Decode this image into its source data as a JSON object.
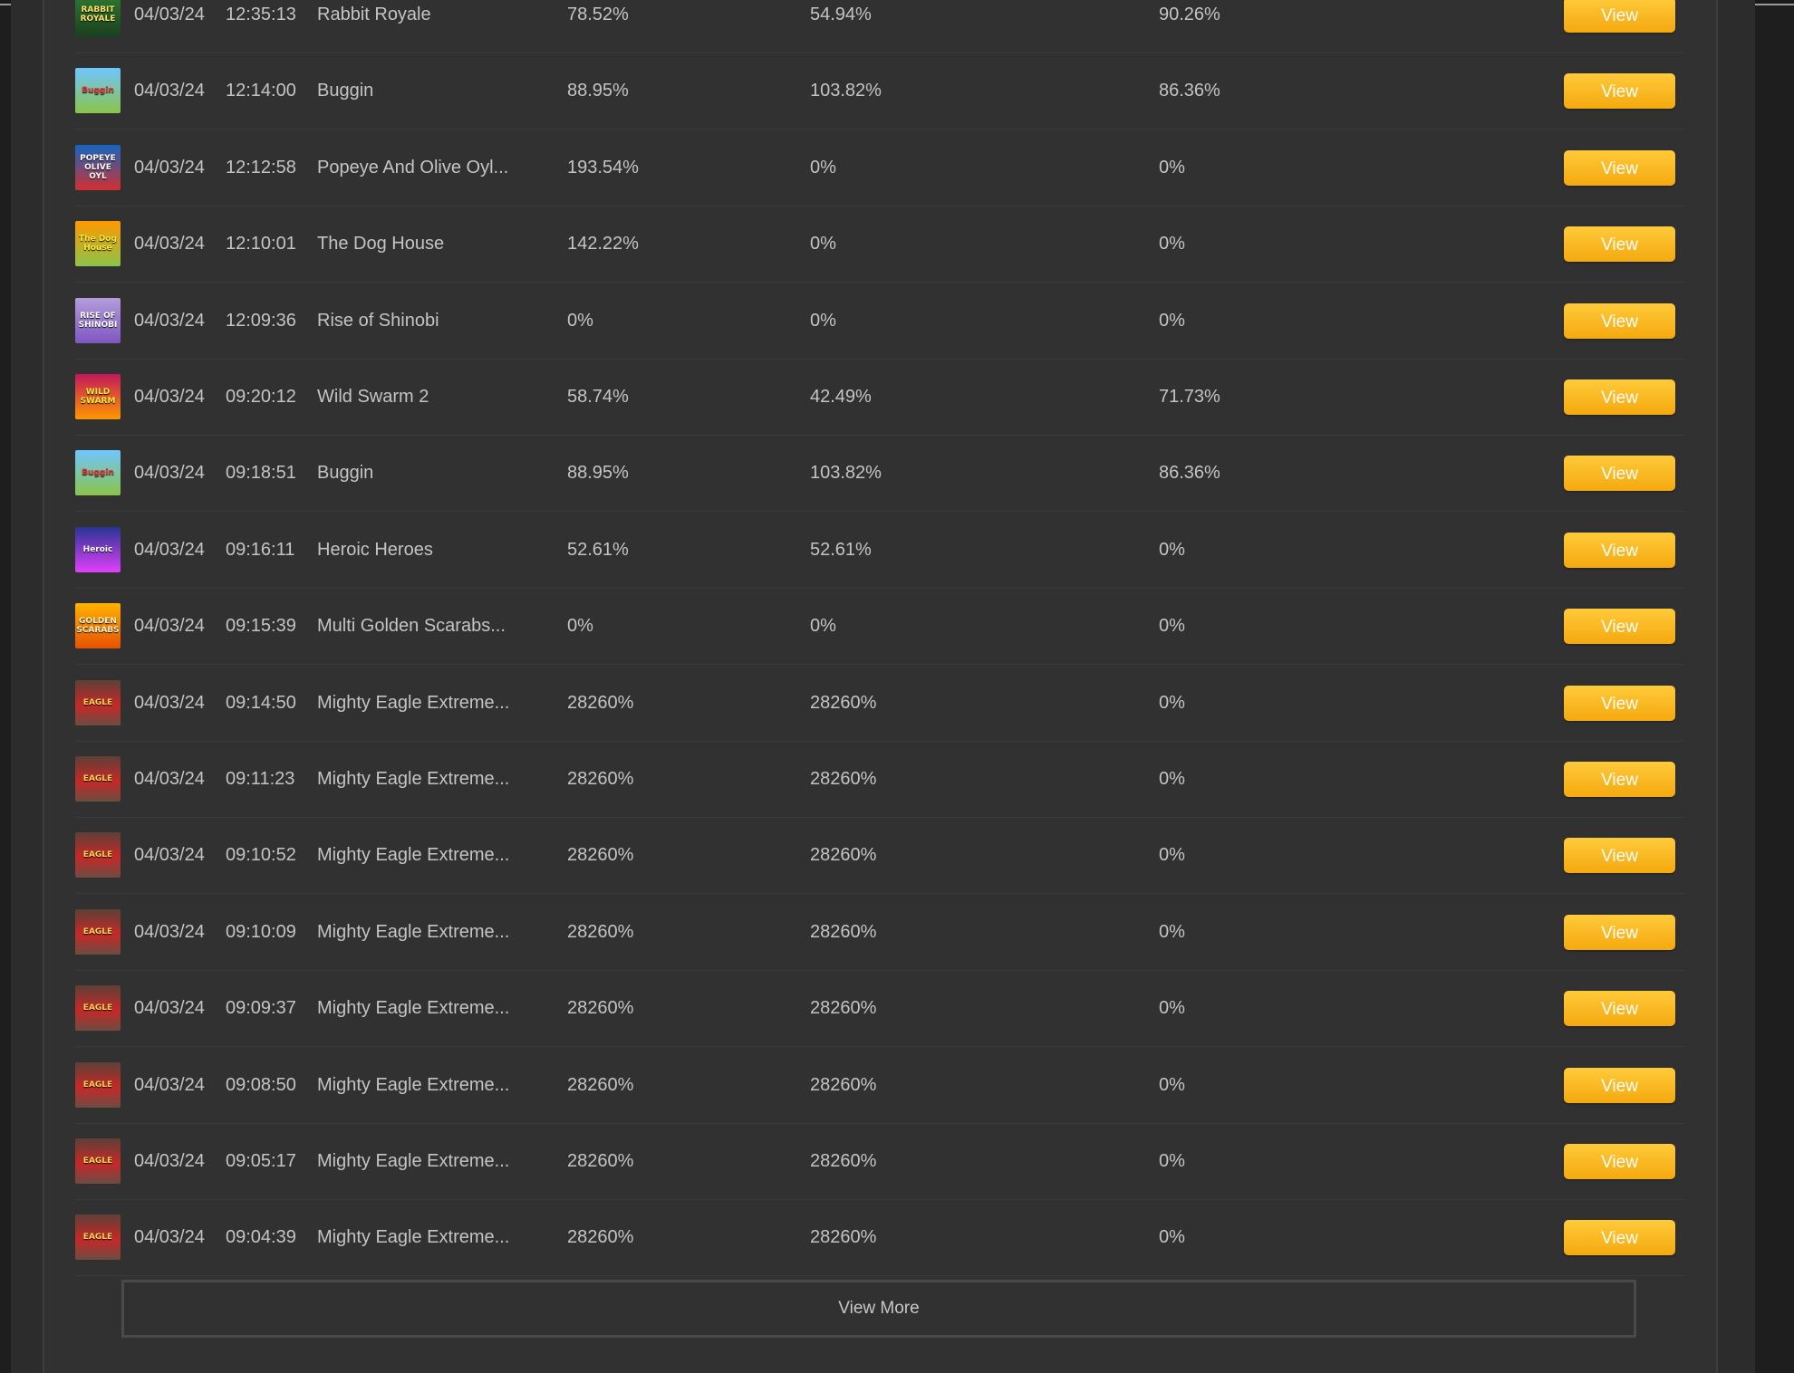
{
  "rows": [
    {
      "date": "04/03/24",
      "time": "12:35:13",
      "game": "Rabbit Royale",
      "r1": "78.52%",
      "r2": "54.94%",
      "r3": "90.26%",
      "thumb": "RABBIT ROYALE",
      "view": "View"
    },
    {
      "date": "04/03/24",
      "time": "12:14:00",
      "game": "Buggin",
      "r1": "88.95%",
      "r2": "103.82%",
      "r3": "86.36%",
      "thumb": "Buggin",
      "view": "View"
    },
    {
      "date": "04/03/24",
      "time": "12:12:58",
      "game": "Popeye And Olive Oyl...",
      "r1": "193.54%",
      "r2": "0%",
      "r3": "0%",
      "thumb": "POPEYE OLIVE OYL",
      "view": "View"
    },
    {
      "date": "04/03/24",
      "time": "12:10:01",
      "game": "The Dog House",
      "r1": "142.22%",
      "r2": "0%",
      "r3": "0%",
      "thumb": "The Dog House",
      "view": "View"
    },
    {
      "date": "04/03/24",
      "time": "12:09:36",
      "game": "Rise of Shinobi",
      "r1": "0%",
      "r2": "0%",
      "r3": "0%",
      "thumb": "RISE OF SHINOBI",
      "view": "View"
    },
    {
      "date": "04/03/24",
      "time": "09:20:12",
      "game": "Wild Swarm 2",
      "r1": "58.74%",
      "r2": "42.49%",
      "r3": "71.73%",
      "thumb": "WILD SWARM",
      "view": "View"
    },
    {
      "date": "04/03/24",
      "time": "09:18:51",
      "game": "Buggin",
      "r1": "88.95%",
      "r2": "103.82%",
      "r3": "86.36%",
      "thumb": "Buggin",
      "view": "View"
    },
    {
      "date": "04/03/24",
      "time": "09:16:11",
      "game": "Heroic Heroes",
      "r1": "52.61%",
      "r2": "52.61%",
      "r3": "0%",
      "thumb": "Heroic",
      "view": "View"
    },
    {
      "date": "04/03/24",
      "time": "09:15:39",
      "game": "Multi Golden Scarabs...",
      "r1": "0%",
      "r2": "0%",
      "r3": "0%",
      "thumb": "GOLDEN SCARABS",
      "view": "View"
    },
    {
      "date": "04/03/24",
      "time": "09:14:50",
      "game": "Mighty Eagle Extreme...",
      "r1": "28260%",
      "r2": "28260%",
      "r3": "0%",
      "thumb": "EAGLE",
      "view": "View"
    },
    {
      "date": "04/03/24",
      "time": "09:11:23",
      "game": "Mighty Eagle Extreme...",
      "r1": "28260%",
      "r2": "28260%",
      "r3": "0%",
      "thumb": "EAGLE",
      "view": "View"
    },
    {
      "date": "04/03/24",
      "time": "09:10:52",
      "game": "Mighty Eagle Extreme...",
      "r1": "28260%",
      "r2": "28260%",
      "r3": "0%",
      "thumb": "EAGLE",
      "view": "View"
    },
    {
      "date": "04/03/24",
      "time": "09:10:09",
      "game": "Mighty Eagle Extreme...",
      "r1": "28260%",
      "r2": "28260%",
      "r3": "0%",
      "thumb": "EAGLE",
      "view": "View"
    },
    {
      "date": "04/03/24",
      "time": "09:09:37",
      "game": "Mighty Eagle Extreme...",
      "r1": "28260%",
      "r2": "28260%",
      "r3": "0%",
      "thumb": "EAGLE",
      "view": "View"
    },
    {
      "date": "04/03/24",
      "time": "09:08:50",
      "game": "Mighty Eagle Extreme...",
      "r1": "28260%",
      "r2": "28260%",
      "r3": "0%",
      "thumb": "EAGLE",
      "view": "View"
    },
    {
      "date": "04/03/24",
      "time": "09:05:17",
      "game": "Mighty Eagle Extreme...",
      "r1": "28260%",
      "r2": "28260%",
      "r3": "0%",
      "thumb": "EAGLE",
      "view": "View"
    },
    {
      "date": "04/03/24",
      "time": "09:04:39",
      "game": "Mighty Eagle Extreme...",
      "r1": "28260%",
      "r2": "28260%",
      "r3": "0%",
      "thumb": "EAGLE",
      "view": "View"
    }
  ],
  "view_more_label": "View More",
  "colors": {
    "page_bg": "#2c2c2c",
    "panel_bg": "#313131",
    "accent": "#f5b21d",
    "text": "#c4c4c4"
  }
}
